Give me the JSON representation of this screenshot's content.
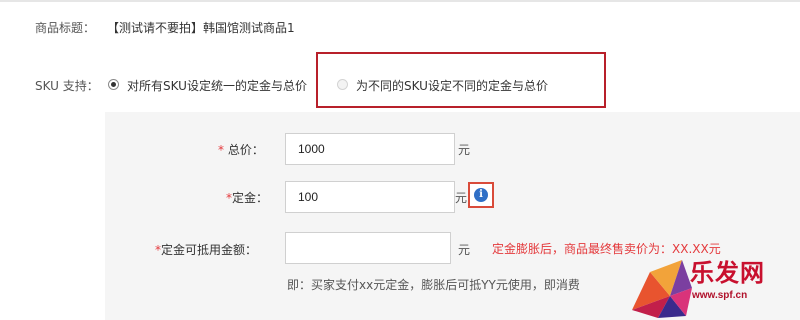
{
  "product": {
    "title_label": "商品标题：",
    "title_value": "【测试请不要拍】韩国馆测试商品1"
  },
  "sku": {
    "label": "SKU 支持：",
    "option_unified": "对所有SKU设定统一的定金与总价",
    "option_per_sku": "为不同的SKU设定不同的定金与总价",
    "selected": "option_unified"
  },
  "form": {
    "total_price": {
      "required_mark": "*",
      "label": " 总价：",
      "value": "1000",
      "unit": "元"
    },
    "deposit": {
      "required_mark": "*",
      "label": "定金：",
      "value": "100",
      "unit": "元",
      "info_icon": "i"
    },
    "deductible": {
      "required_mark": "*",
      "label": "定金可抵用金额：",
      "value": "",
      "unit": "元",
      "warning": "定金膨胀后，商品最终售卖价为：XX.XX元",
      "hint": "即：买家支付xx元定金，膨胀后可抵YY元使用，即消费"
    }
  },
  "watermark": {
    "text": "乐发网",
    "url": "www.spf.cn"
  },
  "colors": {
    "required": "#e4393c",
    "highlight_border": "#b8202a",
    "info_blue": "#2f6fc6",
    "panel_bg": "#f5f5f5"
  }
}
